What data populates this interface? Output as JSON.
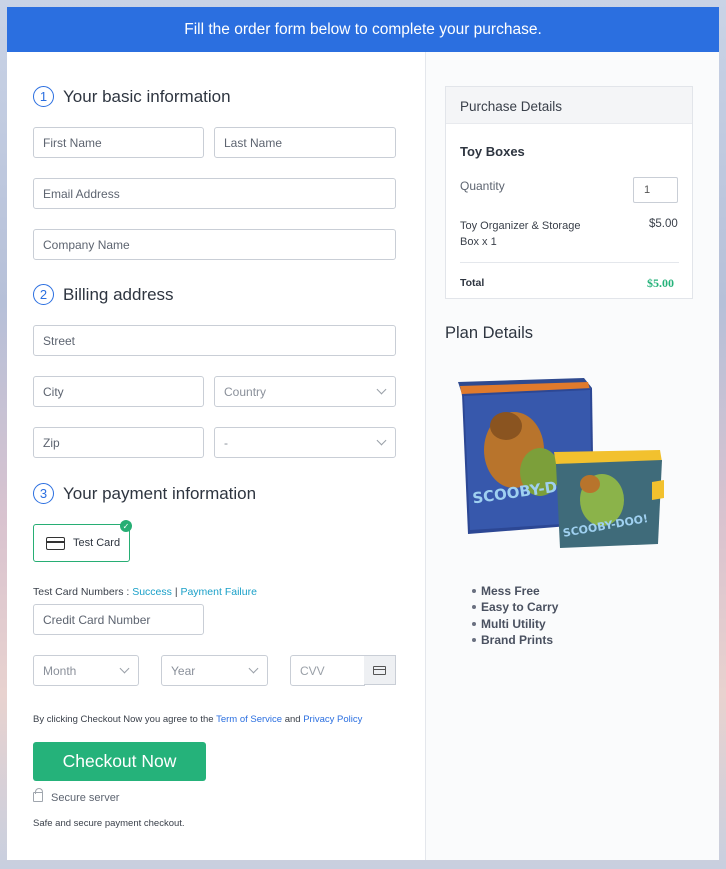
{
  "banner": "Fill the order form below to complete your purchase.",
  "sections": {
    "basic": {
      "num": "1",
      "title": "Your basic information"
    },
    "billing": {
      "num": "2",
      "title": "Billing address"
    },
    "payment": {
      "num": "3",
      "title": "Your payment information"
    }
  },
  "fields": {
    "first_name": "First Name",
    "last_name": "Last Name",
    "email": "Email Address",
    "company": "Company Name",
    "street": "Street",
    "city": "City",
    "country": "Country",
    "zip": "Zip",
    "state": "-",
    "card_number": "Credit Card Number",
    "month": "Month",
    "year": "Year",
    "cvv": "CVV"
  },
  "payment_option": "Test Card",
  "test_numbers": {
    "label": "Test Card Numbers :",
    "success": "Success",
    "sep": "|",
    "failure": "Payment Failure"
  },
  "terms": {
    "prefix": "By clicking Checkout Now you agree to the",
    "terms_link": "Term of Service",
    "and": "and",
    "privacy_link": "Privacy Policy"
  },
  "checkout_label": "Checkout Now",
  "secure_label": "Secure server",
  "safe_label": "Safe and secure payment checkout.",
  "purchase": {
    "header": "Purchase Details",
    "product": "Toy Boxes",
    "quantity_label": "Quantity",
    "quantity_value": "1",
    "item_line1": "Toy Organizer & Storage",
    "item_line2": "Box x 1",
    "item_price": "$5.00",
    "total_label": "Total",
    "total_value": "$5.00"
  },
  "plan": {
    "title": "Plan Details",
    "image_text": "SCOOBY-DOO!",
    "features": [
      "Mess Free",
      "Easy to Carry",
      "Multi Utility",
      "Brand Prints"
    ]
  },
  "colors": {
    "accent": "#2b6fe0",
    "success": "#25b27a",
    "link": "#1aa0c8"
  }
}
